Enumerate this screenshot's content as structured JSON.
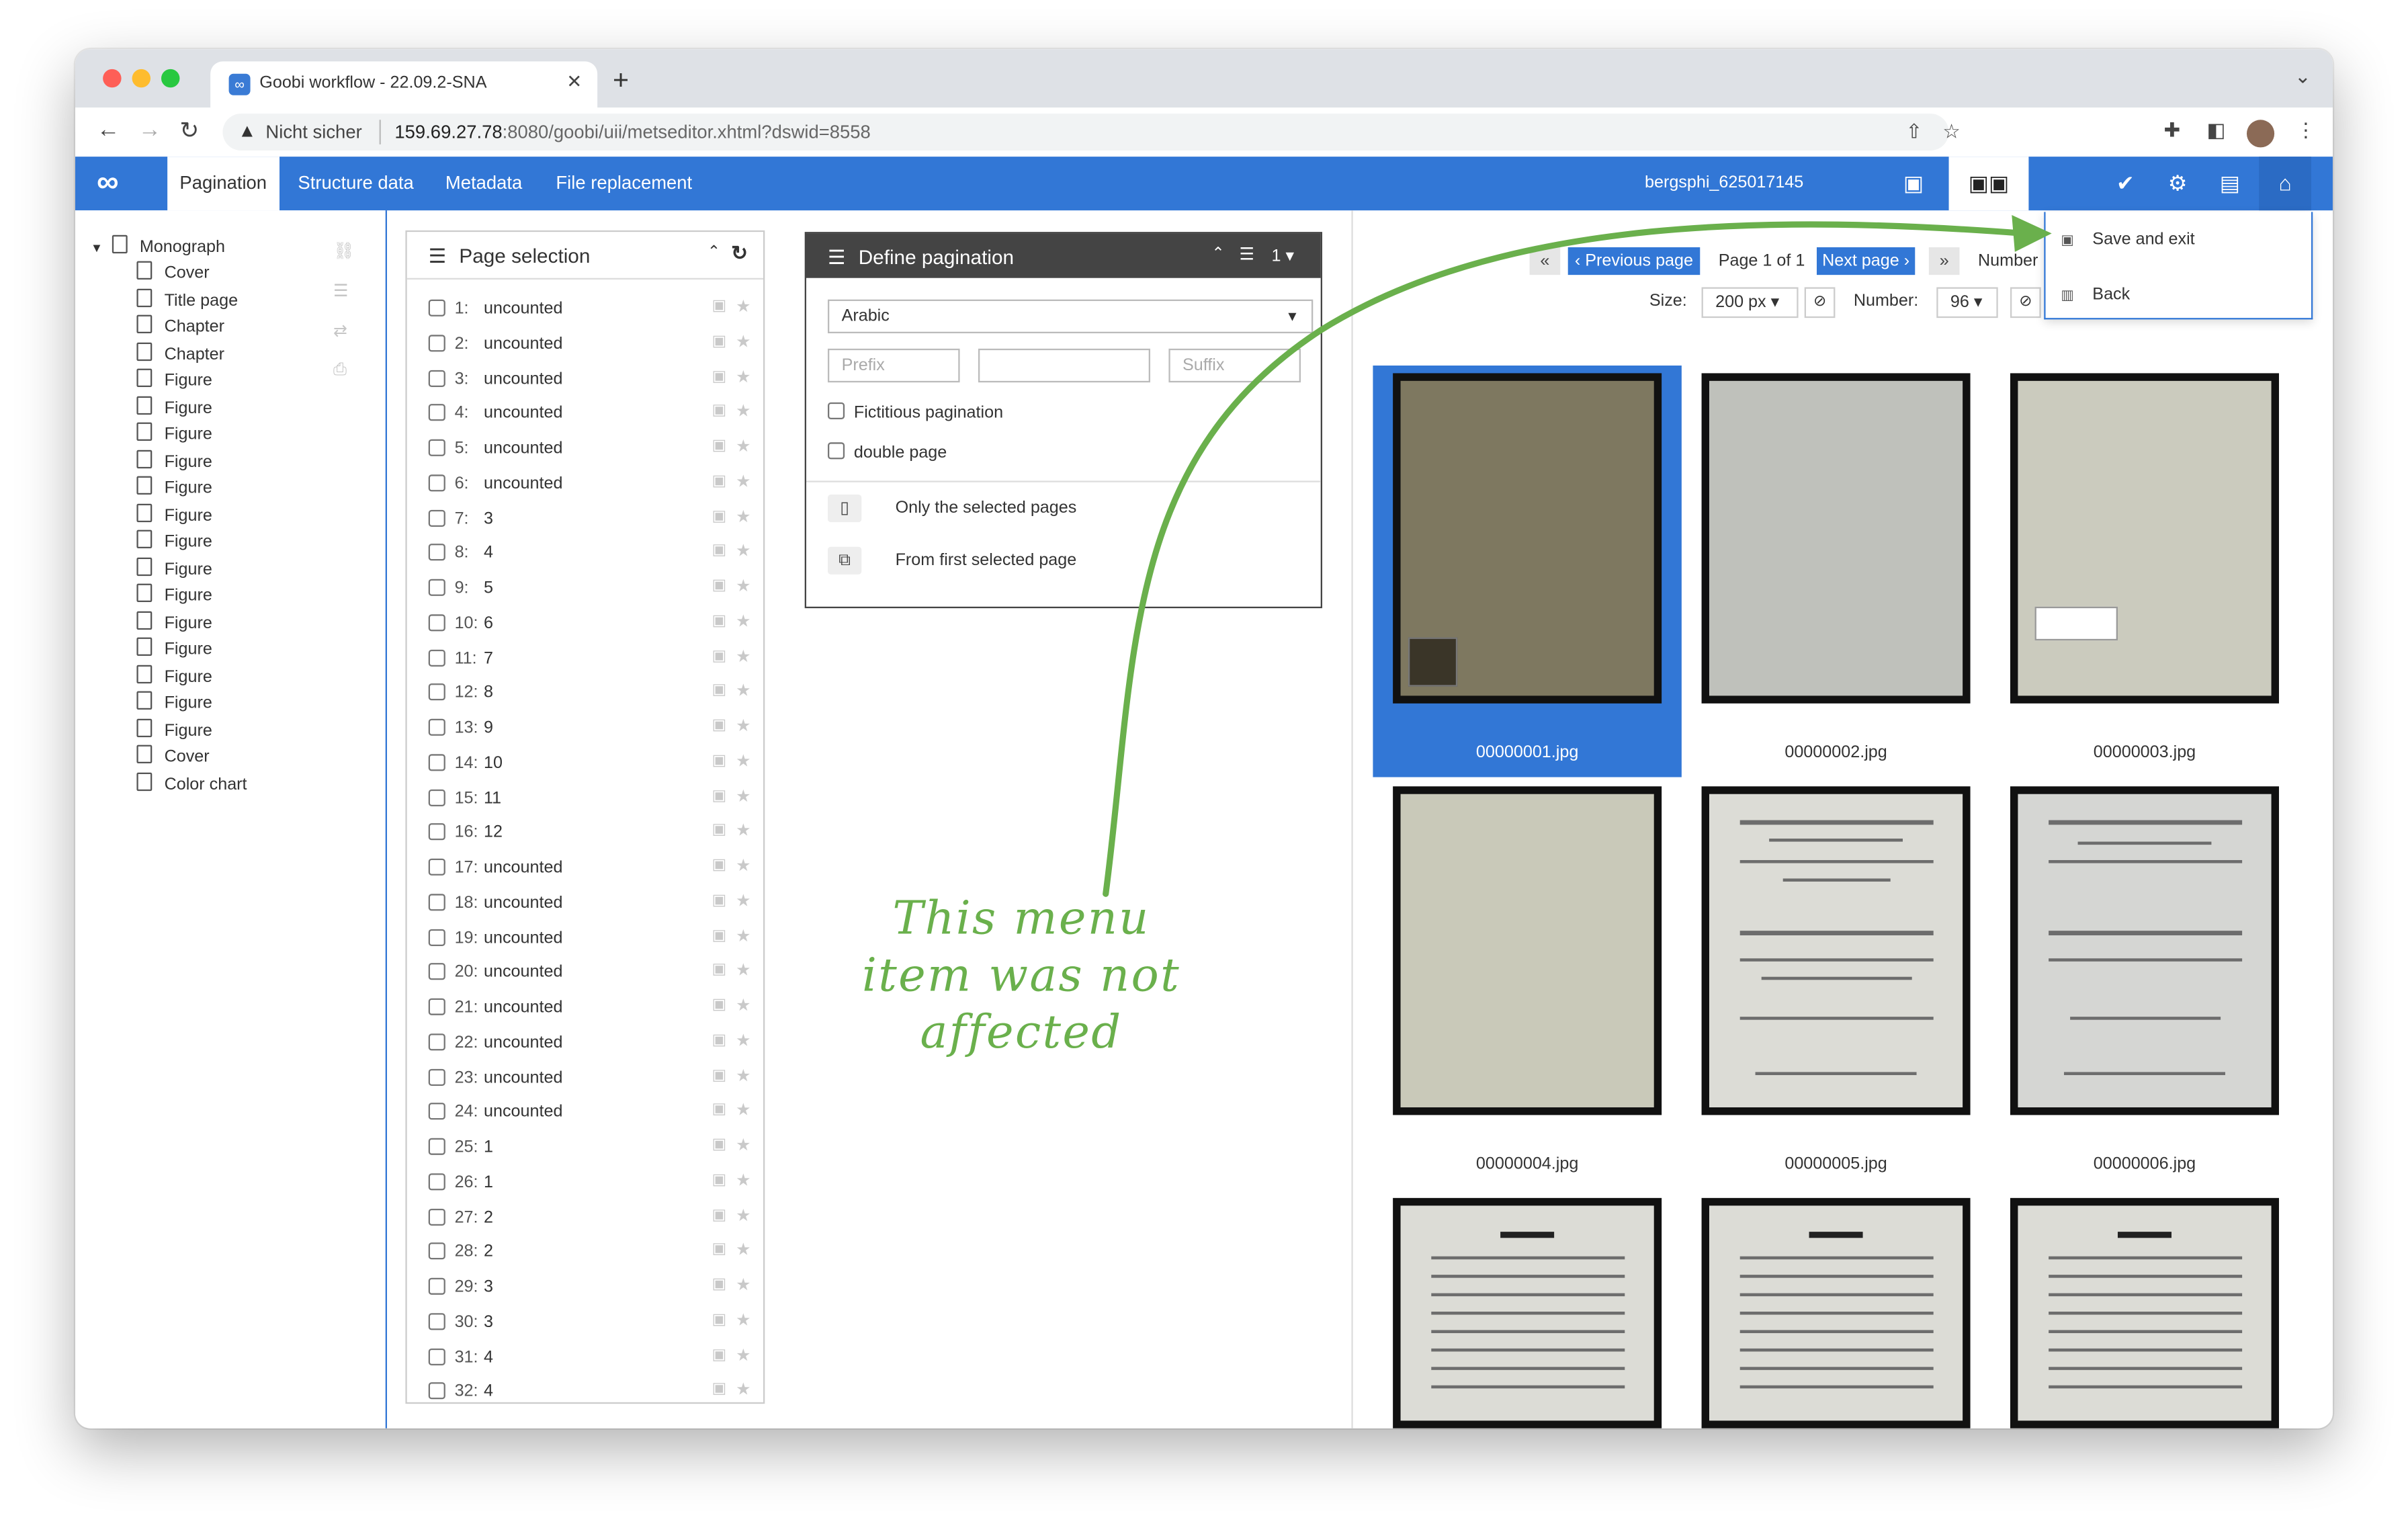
{
  "browser": {
    "tab_title": "Goobi workflow - 22.09.2-SNA",
    "tab_favicon": "∞",
    "close_glyph": "✕",
    "newtab_glyph": "+",
    "security_label": "Nicht sicher",
    "url_host": "159.69.27.78",
    "url_rest": ":8080/goobi/uii/metseditor.xhtml?dswid=8558"
  },
  "app": {
    "logo": "∞",
    "tabs": [
      "Pagination",
      "Structure data",
      "Metadata",
      "File replacement"
    ],
    "process_name": "bergsphi_625017145"
  },
  "tree": {
    "root": "Monograph",
    "items": [
      "Cover",
      "Title page",
      "Chapter",
      "Chapter",
      "Figure",
      "Figure",
      "Figure",
      "Figure",
      "Figure",
      "Figure",
      "Figure",
      "Figure",
      "Figure",
      "Figure",
      "Figure",
      "Figure",
      "Figure",
      "Figure",
      "Cover",
      "Color chart"
    ]
  },
  "page_selection": {
    "title": "Page selection",
    "rows": [
      {
        "n": "1:",
        "v": "uncounted"
      },
      {
        "n": "2:",
        "v": "uncounted"
      },
      {
        "n": "3:",
        "v": "uncounted"
      },
      {
        "n": "4:",
        "v": "uncounted"
      },
      {
        "n": "5:",
        "v": "uncounted"
      },
      {
        "n": "6:",
        "v": "uncounted"
      },
      {
        "n": "7:",
        "v": "3"
      },
      {
        "n": "8:",
        "v": "4"
      },
      {
        "n": "9:",
        "v": "5"
      },
      {
        "n": "10:",
        "v": "6"
      },
      {
        "n": "11:",
        "v": "7"
      },
      {
        "n": "12:",
        "v": "8"
      },
      {
        "n": "13:",
        "v": "9"
      },
      {
        "n": "14:",
        "v": "10"
      },
      {
        "n": "15:",
        "v": "11"
      },
      {
        "n": "16:",
        "v": "12"
      },
      {
        "n": "17:",
        "v": "uncounted"
      },
      {
        "n": "18:",
        "v": "uncounted"
      },
      {
        "n": "19:",
        "v": "uncounted"
      },
      {
        "n": "20:",
        "v": "uncounted"
      },
      {
        "n": "21:",
        "v": "uncounted"
      },
      {
        "n": "22:",
        "v": "uncounted"
      },
      {
        "n": "23:",
        "v": "uncounted"
      },
      {
        "n": "24:",
        "v": "uncounted"
      },
      {
        "n": "25:",
        "v": "1"
      },
      {
        "n": "26:",
        "v": "1"
      },
      {
        "n": "27:",
        "v": "2"
      },
      {
        "n": "28:",
        "v": "2"
      },
      {
        "n": "29:",
        "v": "3"
      },
      {
        "n": "30:",
        "v": "3"
      },
      {
        "n": "31:",
        "v": "4"
      },
      {
        "n": "32:",
        "v": "4"
      }
    ]
  },
  "define_pagination": {
    "title": "Define pagination",
    "header_count": "1",
    "type_value": "Arabic",
    "prefix_placeholder": "Prefix",
    "suffix_placeholder": "Suffix",
    "fictitious_label": "Fictitious pagination",
    "double_label": "double page",
    "only_selected_label": "Only the selected pages",
    "from_first_label": "From first selected page"
  },
  "thumbnails": {
    "first_glyph": "«",
    "prev_label": "‹ Previous page",
    "page_info": "Page 1 of 1",
    "next_label": "Next page ›",
    "last_glyph": "»",
    "number_label_top": "Number",
    "size_label": "Size:",
    "size_value": "200 px",
    "number_label": "Number:",
    "number_value": "96",
    "files": [
      "00000001.jpg",
      "00000002.jpg",
      "00000003.jpg",
      "00000004.jpg",
      "00000005.jpg",
      "00000006.jpg"
    ]
  },
  "menu": {
    "save_exit": "Save and exit",
    "back": "Back"
  },
  "annotation": "This menu item was not affected",
  "colors": {
    "accent": "#3277d6",
    "annotation": "#6ab04c",
    "dark_header": "#444444"
  }
}
